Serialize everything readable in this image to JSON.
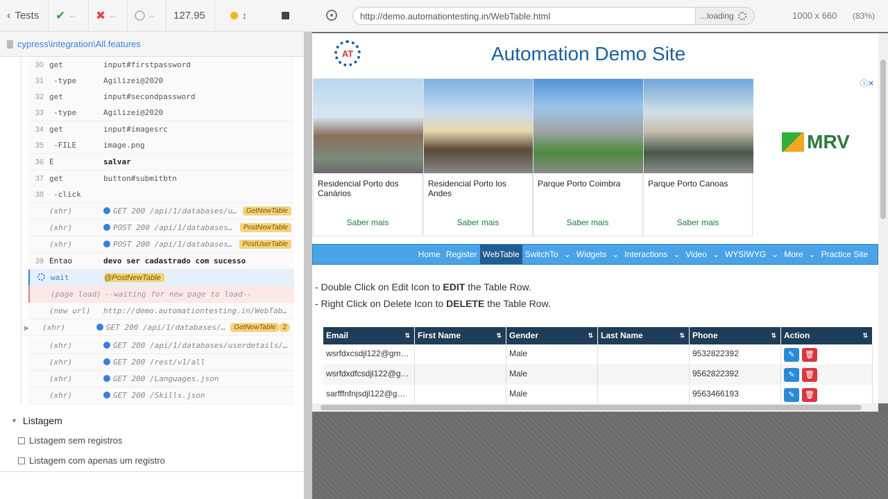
{
  "runner": {
    "tests_label": "Tests",
    "passed": "--",
    "failed": "--",
    "pending": "--",
    "duration": "127.95",
    "spec_path": "cypress\\integration\\All.features"
  },
  "commands": [
    {
      "num": "30",
      "name": "get",
      "arg": "input#firstpassword"
    },
    {
      "num": "31",
      "name": "-type",
      "arg": "Agilizei@2020"
    },
    {
      "num": "32",
      "name": "get",
      "arg": "input#secondpassword"
    },
    {
      "num": "33",
      "name": "-type",
      "arg": "Agilizei@2020"
    },
    {
      "num": "34",
      "name": "get",
      "arg": "input#imagesrc"
    },
    {
      "num": "35",
      "name": "-FILE",
      "arg": "image.png"
    },
    {
      "num": "36",
      "name": "E",
      "arg": "salvar"
    },
    {
      "num": "37",
      "name": "get",
      "arg": "button#submitbtn"
    },
    {
      "num": "38",
      "name": "-click",
      "arg": ""
    },
    {
      "num": "",
      "name": "(xhr)",
      "arg": "GET 200 /api/1/databases/u…",
      "alias": "GetNewTable"
    },
    {
      "num": "",
      "name": "(xhr)",
      "arg": "POST 200 /api/1/databases…",
      "alias": "PostNewTable"
    },
    {
      "num": "",
      "name": "(xhr)",
      "arg": "POST 200 /api/1/databases…",
      "alias": "PostUserTable"
    },
    {
      "num": "39",
      "name": "Entao",
      "arg": "devo ser cadastrado com sucesso"
    },
    {
      "num": "",
      "name": "wait",
      "arg": "@PostNewTable"
    },
    {
      "num": "",
      "name": "(page load)",
      "arg": "--waiting for new page to load--"
    },
    {
      "num": "",
      "name": "(new url)",
      "arg": "http://demo.automationtesting.in/WebTab…"
    },
    {
      "num": "",
      "name": "(xhr)",
      "arg": "GET 200 /api/1/databases/…",
      "alias": "GetNewTable",
      "count": "2"
    },
    {
      "num": "",
      "name": "(xhr)",
      "arg": "GET 200 /api/1/databases/userdetails/…"
    },
    {
      "num": "",
      "name": "(xhr)",
      "arg": "GET 200 /rest/v1/all"
    },
    {
      "num": "",
      "name": "(xhr)",
      "arg": "GET 200 /Languages.json"
    },
    {
      "num": "",
      "name": "(xhr)",
      "arg": "GET 200 /Skills.json"
    }
  ],
  "suite": {
    "title": "Listagem",
    "tests": [
      "Listagem sem registros",
      "Listagem com apenas um registro"
    ]
  },
  "browser": {
    "url": "http://demo.automationtesting.in/WebTable.html",
    "loading": "...loading",
    "viewport": "1000 x 660",
    "zoom": "(83%)"
  },
  "site": {
    "title": "Automation Demo Site",
    "logo_text": "AT",
    "ads": [
      {
        "title": "Residencial Porto dos Canários",
        "cta": "Saber mais"
      },
      {
        "title": "Residencial Porto los Andes",
        "cta": "Saber mais"
      },
      {
        "title": "Parque Porto Coimbra",
        "cta": "Saber mais"
      },
      {
        "title": "Parque Porto Canoas",
        "cta": "Saber mais"
      }
    ],
    "brand": "MRV",
    "nav": [
      "Home",
      "Register",
      "WebTable",
      "SwitchTo",
      "Widgets",
      "Interactions",
      "Video",
      "WYSIWYG",
      "More",
      "Practice Site"
    ],
    "instr1": {
      "pre": "- Double Click on Edit Icon to ",
      "bold": "EDIT",
      "post": " the Table Row."
    },
    "instr2": {
      "pre": "- Right Click on Delete Icon to ",
      "bold": "DELETE",
      "post": " the Table Row."
    },
    "columns": [
      "Email",
      "First Name",
      "Gender",
      "Last Name",
      "Phone",
      "Action"
    ],
    "rows": [
      {
        "email": "wsrfdxcsdjl122@gma…",
        "first": "",
        "gender": "Male",
        "last": "",
        "phone": "9532822392"
      },
      {
        "email": "wsrfdxdfcsdjl122@g…",
        "first": "",
        "gender": "Male",
        "last": "",
        "phone": "9562822392"
      },
      {
        "email": "sarfffnfnjsdjl122@gm…",
        "first": "",
        "gender": "Male",
        "last": "",
        "phone": "9563466193"
      }
    ]
  }
}
